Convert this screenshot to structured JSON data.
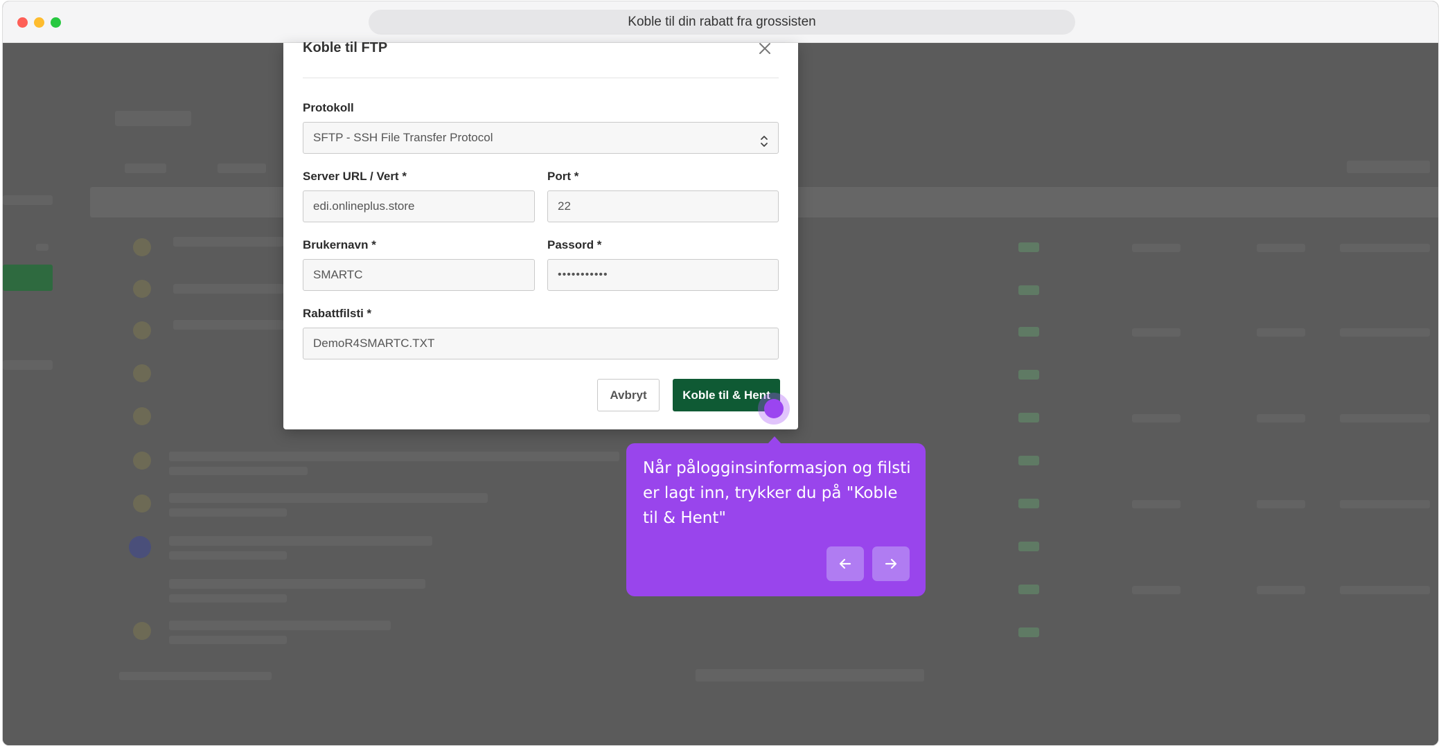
{
  "browser": {
    "url_title": "Koble til din rabatt fra grossisten"
  },
  "modal": {
    "title": "Koble til FTP",
    "fields": {
      "protocol": {
        "label": "Protokoll",
        "value": "SFTP - SSH File Transfer Protocol"
      },
      "server": {
        "label": "Server URL / Vert *",
        "value": "edi.onlineplus.store"
      },
      "port": {
        "label": "Port *",
        "value": "22"
      },
      "username": {
        "label": "Brukernavn *",
        "value": "SMARTC"
      },
      "password": {
        "label": "Passord *",
        "value": "•••••••••••"
      },
      "discount_file": {
        "label": "Rabattfilsti *",
        "value": "DemoR4SMARTC.TXT"
      }
    },
    "buttons": {
      "cancel": "Avbryt",
      "connect": "Koble til & Hent"
    }
  },
  "tooltip": {
    "text": "Når pålogginsinformasjon og filsti er lagt inn, trykker du på \"Koble til & Hent\""
  },
  "colors": {
    "primary_button": "#0f5a34",
    "tooltip_bg": "#9945ec",
    "overlay": "#5b5b5b"
  },
  "icons": {
    "close": "close-icon",
    "select": "chevron-up-down-icon",
    "prev": "arrow-left-icon",
    "next": "arrow-right-icon"
  }
}
